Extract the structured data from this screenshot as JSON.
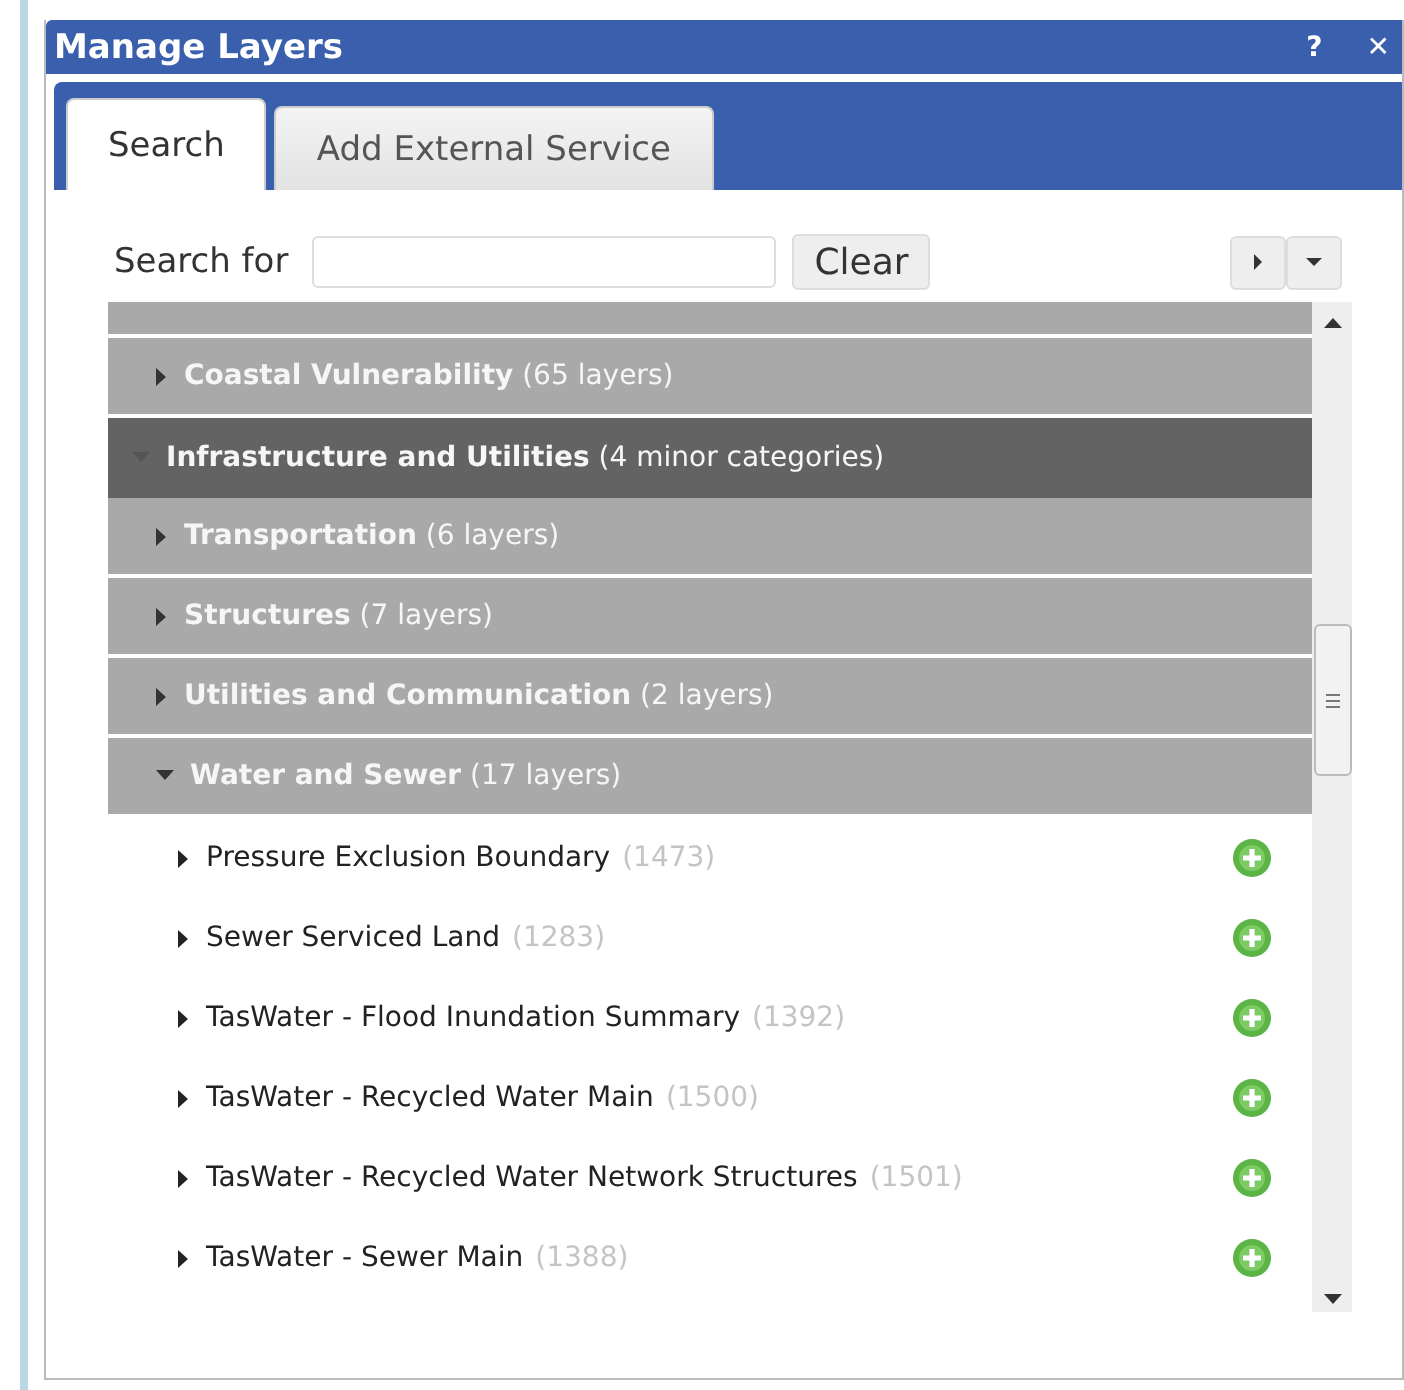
{
  "window": {
    "title": "Manage Layers",
    "help": "?",
    "close": "✕"
  },
  "tabs": [
    {
      "label": "Search",
      "selected": true
    },
    {
      "label": "Add External Service",
      "selected": false
    }
  ],
  "search": {
    "label": "Search for",
    "clear": "Clear"
  },
  "categories": [
    {
      "name": "Coastal Vulnerability",
      "count": "(65 layers)",
      "expanded": false
    },
    {
      "name": "Infrastructure and Utilities",
      "count": "(4 minor categories)",
      "expanded": true,
      "children": [
        {
          "name": "Transportation",
          "count": "(6 layers)",
          "expanded": false
        },
        {
          "name": "Structures",
          "count": "(7 layers)",
          "expanded": false
        },
        {
          "name": "Utilities and Communication",
          "count": "(2 layers)",
          "expanded": false
        },
        {
          "name": "Water and Sewer",
          "count": "(17 layers)",
          "expanded": true,
          "children": [
            {
              "name": "Pressure Exclusion Boundary",
              "count": "(1473)"
            },
            {
              "name": "Sewer Serviced Land",
              "count": "(1283)"
            },
            {
              "name": "TasWater - Flood Inundation Summary",
              "count": "(1392)"
            },
            {
              "name": "TasWater - Recycled Water Main",
              "count": "(1500)"
            },
            {
              "name": "TasWater - Recycled Water Network Structures",
              "count": "(1501)"
            },
            {
              "name": "TasWater - Sewer Main",
              "count": "(1388)"
            }
          ]
        }
      ]
    }
  ]
}
